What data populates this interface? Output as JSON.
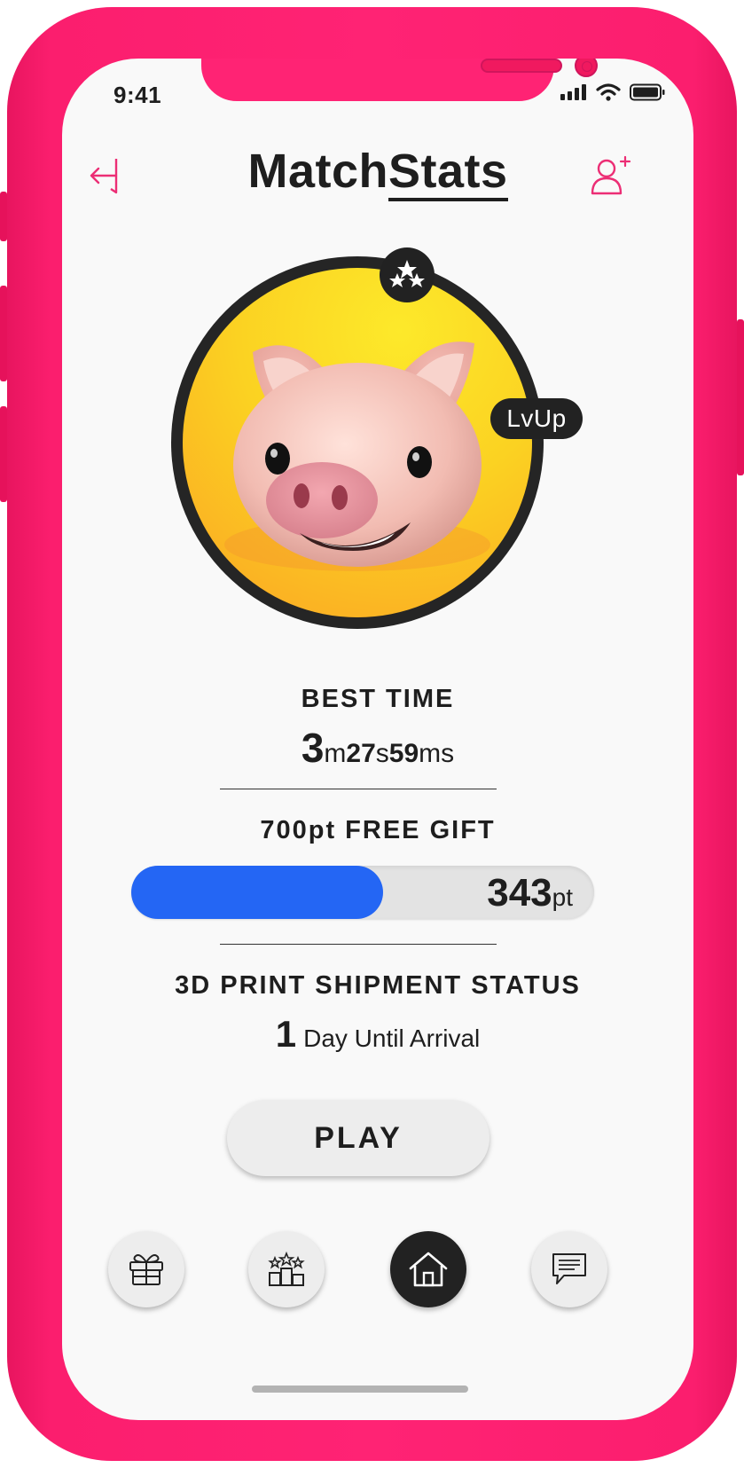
{
  "status_bar": {
    "time": "9:41"
  },
  "header": {
    "title_part1": "Match",
    "title_part2": "Stats"
  },
  "avatar": {
    "level_badge": "LvUp"
  },
  "best_time": {
    "label": "BEST TIME",
    "minutes": "3",
    "minutes_unit": "m",
    "seconds": "27",
    "seconds_unit": "s",
    "milliseconds": "59",
    "milliseconds_unit": "ms"
  },
  "gift": {
    "label": "700pt FREE GIFT",
    "points": "343",
    "points_unit": "pt",
    "progress_fraction": 0.545
  },
  "shipment": {
    "label": "3D PRINT SHIPMENT STATUS",
    "days": "1",
    "days_text": "Day Until Arrival"
  },
  "play_button": {
    "label": "PLAY"
  },
  "bottom_nav": {
    "items": [
      {
        "icon": "gift-icon",
        "active": false
      },
      {
        "icon": "ranking-icon",
        "active": false
      },
      {
        "icon": "home-icon",
        "active": true
      },
      {
        "icon": "chat-icon",
        "active": false
      }
    ]
  },
  "colors": {
    "frame": "#ff2374",
    "accent": "#2466f4",
    "avatar_bg": "#fbd222",
    "dark": "#222222"
  }
}
